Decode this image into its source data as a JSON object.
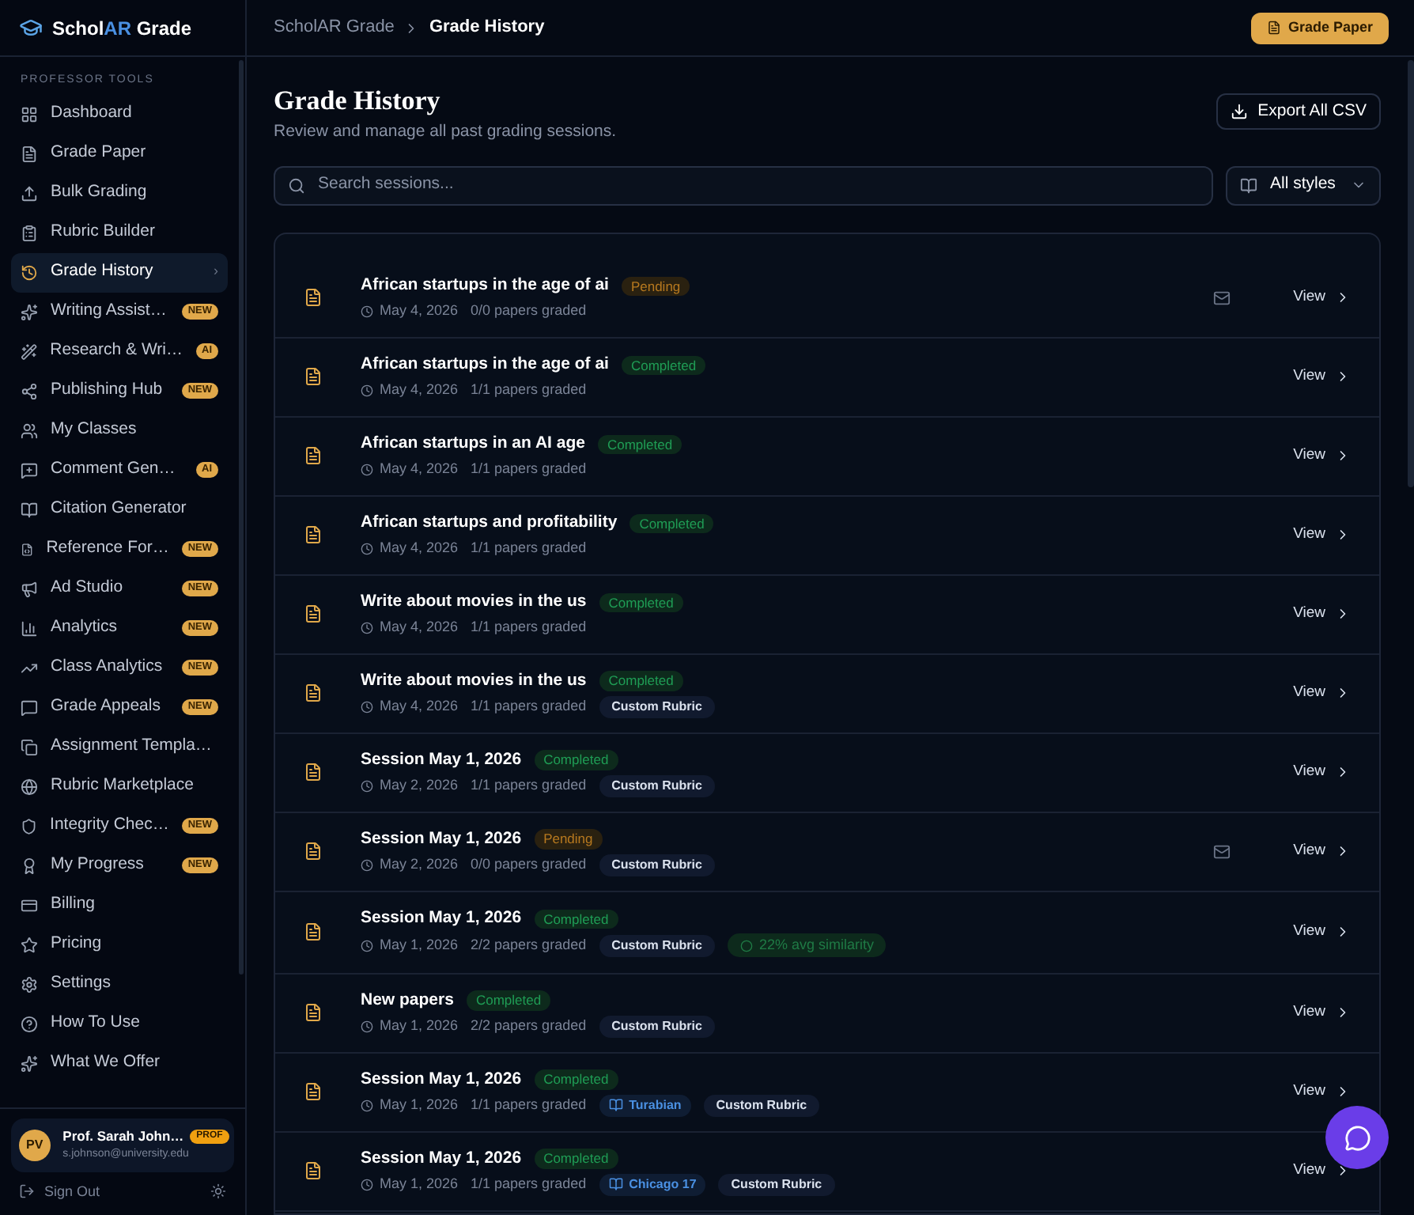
{
  "brand": {
    "prefix": "Schol",
    "highlight": "AR",
    "suffix": " Grade"
  },
  "sidebar": {
    "section": "PROFESSOR TOOLS",
    "items": [
      {
        "label": "Dashboard",
        "selected": false
      },
      {
        "label": "Grade Paper",
        "selected": false
      },
      {
        "label": "Bulk Grading",
        "selected": false
      },
      {
        "label": "Rubric Builder",
        "selected": false
      },
      {
        "label": "Grade History",
        "selected": true,
        "chevron": "›"
      },
      {
        "label": "Writing Assist…",
        "selected": false,
        "badge": "NEW"
      },
      {
        "label": "Research & Wri…",
        "selected": false,
        "badge": "AI"
      },
      {
        "label": "Publishing Hub",
        "selected": false,
        "badge": "NEW"
      },
      {
        "label": "My Classes",
        "selected": false
      },
      {
        "label": "Comment Gen…",
        "selected": false,
        "badge": "AI"
      },
      {
        "label": "Citation Generator",
        "selected": false
      },
      {
        "label": "Reference For…",
        "selected": false,
        "badge": "NEW"
      },
      {
        "label": "Ad Studio",
        "selected": false,
        "badge": "NEW"
      },
      {
        "label": "Analytics",
        "selected": false,
        "badge": "NEW"
      },
      {
        "label": "Class Analytics",
        "selected": false,
        "badge": "NEW"
      },
      {
        "label": "Grade Appeals",
        "selected": false,
        "badge": "NEW"
      },
      {
        "label": "Assignment Templa…",
        "selected": false
      },
      {
        "label": "Rubric Marketplace",
        "selected": false
      },
      {
        "label": "Integrity Chec…",
        "selected": false,
        "badge": "NEW"
      },
      {
        "label": "My Progress",
        "selected": false,
        "badge": "NEW"
      },
      {
        "label": "Billing",
        "selected": false
      },
      {
        "label": "Pricing",
        "selected": false
      },
      {
        "label": "Settings",
        "selected": false
      },
      {
        "label": "How To Use",
        "selected": false
      },
      {
        "label": "What We Offer",
        "selected": false
      }
    ],
    "user": {
      "initials": "PV",
      "name": "Prof. Sarah John…",
      "badge": "PROF",
      "email": "s.johnson@university.edu"
    },
    "sign_out": "Sign Out"
  },
  "topbar": {
    "breadcrumb": [
      "ScholAR Grade",
      "Grade History"
    ],
    "button": "Grade Paper"
  },
  "page": {
    "title": "Grade History",
    "subtitle": "Review and manage all past grading sessions.",
    "export": "Export All CSV",
    "search": {
      "placeholder": "Search sessions..."
    },
    "filter": "All styles"
  },
  "sessions": [
    {
      "title": "African startups in the age of ai",
      "status": {
        "kind": "pending",
        "label": "Pending"
      },
      "date": "May 4, 2026",
      "papers": "0/0 papers graded",
      "mail": true,
      "action": "View"
    },
    {
      "title": "African startups in the age of ai",
      "status": {
        "kind": "completed",
        "label": "Completed"
      },
      "date": "May 4, 2026",
      "papers": "1/1 papers graded",
      "mail": false,
      "action": "View"
    },
    {
      "title": "African startups in an AI age",
      "status": {
        "kind": "completed",
        "label": "Completed"
      },
      "date": "May 4, 2026",
      "papers": "1/1 papers graded",
      "mail": false,
      "action": "View"
    },
    {
      "title": "African startups and profitability",
      "status": {
        "kind": "completed",
        "label": "Completed"
      },
      "date": "May 4, 2026",
      "papers": "1/1 papers graded",
      "mail": false,
      "action": "View"
    },
    {
      "title": "Write about movies in the us",
      "status": {
        "kind": "completed",
        "label": "Completed"
      },
      "date": "May 4, 2026",
      "papers": "1/1 papers graded",
      "mail": false,
      "action": "View"
    },
    {
      "title": "Write about movies in the us",
      "status": {
        "kind": "completed",
        "label": "Completed"
      },
      "date": "May 4, 2026",
      "papers": "1/1 papers graded",
      "mail": false,
      "action": "View",
      "tags": [
        {
          "kind": "rubric",
          "label": "Custom Rubric"
        }
      ]
    },
    {
      "title": "Session May 1, 2026",
      "status": {
        "kind": "completed",
        "label": "Completed"
      },
      "date": "May 2, 2026",
      "papers": "1/1 papers graded",
      "mail": false,
      "action": "View",
      "tags": [
        {
          "kind": "rubric",
          "label": "Custom Rubric"
        }
      ]
    },
    {
      "title": "Session May 1, 2026",
      "status": {
        "kind": "pending",
        "label": "Pending"
      },
      "date": "May 2, 2026",
      "papers": "0/0 papers graded",
      "mail": true,
      "action": "View",
      "tags": [
        {
          "kind": "rubric",
          "label": "Custom Rubric"
        }
      ]
    },
    {
      "title": "Session May 1, 2026",
      "status": {
        "kind": "completed",
        "label": "Completed"
      },
      "date": "May 1, 2026",
      "papers": "2/2 papers graded",
      "mail": false,
      "action": "View",
      "tags": [
        {
          "kind": "rubric",
          "label": "Custom Rubric"
        },
        {
          "kind": "similarity",
          "label": "22% avg similarity"
        }
      ]
    },
    {
      "title": "New papers",
      "status": {
        "kind": "completed",
        "label": "Completed"
      },
      "date": "May 1, 2026",
      "papers": "2/2 papers graded",
      "mail": false,
      "action": "View",
      "tags": [
        {
          "kind": "rubric",
          "label": "Custom Rubric"
        }
      ]
    },
    {
      "title": "Session May 1, 2026",
      "status": {
        "kind": "completed",
        "label": "Completed"
      },
      "date": "May 1, 2026",
      "papers": "1/1 papers graded",
      "mail": false,
      "action": "View",
      "tags": [
        {
          "kind": "style",
          "label": "Turabian"
        },
        {
          "kind": "rubric",
          "label": "Custom Rubric"
        }
      ]
    },
    {
      "title": "Session May 1, 2026",
      "status": {
        "kind": "completed",
        "label": "Completed"
      },
      "date": "May 1, 2026",
      "papers": "1/1 papers graded",
      "mail": false,
      "action": "View",
      "tags": [
        {
          "kind": "style",
          "label": "Chicago 17"
        },
        {
          "kind": "rubric",
          "label": "Custom Rubric"
        }
      ]
    }
  ]
}
